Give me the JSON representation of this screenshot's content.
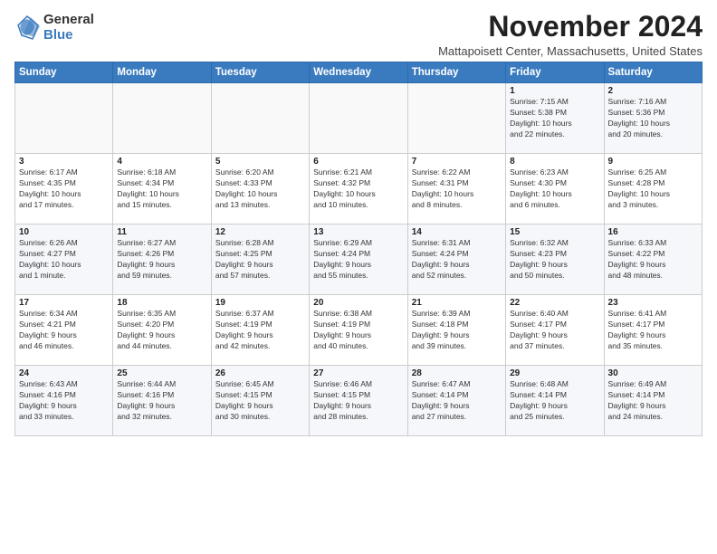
{
  "logo": {
    "general": "General",
    "blue": "Blue"
  },
  "title": "November 2024",
  "location": "Mattapoisett Center, Massachusetts, United States",
  "days_header": [
    "Sunday",
    "Monday",
    "Tuesday",
    "Wednesday",
    "Thursday",
    "Friday",
    "Saturday"
  ],
  "weeks": [
    [
      {
        "day": "",
        "detail": ""
      },
      {
        "day": "",
        "detail": ""
      },
      {
        "day": "",
        "detail": ""
      },
      {
        "day": "",
        "detail": ""
      },
      {
        "day": "",
        "detail": ""
      },
      {
        "day": "1",
        "detail": "Sunrise: 7:15 AM\nSunset: 5:38 PM\nDaylight: 10 hours\nand 22 minutes."
      },
      {
        "day": "2",
        "detail": "Sunrise: 7:16 AM\nSunset: 5:36 PM\nDaylight: 10 hours\nand 20 minutes."
      }
    ],
    [
      {
        "day": "3",
        "detail": "Sunrise: 6:17 AM\nSunset: 4:35 PM\nDaylight: 10 hours\nand 17 minutes."
      },
      {
        "day": "4",
        "detail": "Sunrise: 6:18 AM\nSunset: 4:34 PM\nDaylight: 10 hours\nand 15 minutes."
      },
      {
        "day": "5",
        "detail": "Sunrise: 6:20 AM\nSunset: 4:33 PM\nDaylight: 10 hours\nand 13 minutes."
      },
      {
        "day": "6",
        "detail": "Sunrise: 6:21 AM\nSunset: 4:32 PM\nDaylight: 10 hours\nand 10 minutes."
      },
      {
        "day": "7",
        "detail": "Sunrise: 6:22 AM\nSunset: 4:31 PM\nDaylight: 10 hours\nand 8 minutes."
      },
      {
        "day": "8",
        "detail": "Sunrise: 6:23 AM\nSunset: 4:30 PM\nDaylight: 10 hours\nand 6 minutes."
      },
      {
        "day": "9",
        "detail": "Sunrise: 6:25 AM\nSunset: 4:28 PM\nDaylight: 10 hours\nand 3 minutes."
      }
    ],
    [
      {
        "day": "10",
        "detail": "Sunrise: 6:26 AM\nSunset: 4:27 PM\nDaylight: 10 hours\nand 1 minute."
      },
      {
        "day": "11",
        "detail": "Sunrise: 6:27 AM\nSunset: 4:26 PM\nDaylight: 9 hours\nand 59 minutes."
      },
      {
        "day": "12",
        "detail": "Sunrise: 6:28 AM\nSunset: 4:25 PM\nDaylight: 9 hours\nand 57 minutes."
      },
      {
        "day": "13",
        "detail": "Sunrise: 6:29 AM\nSunset: 4:24 PM\nDaylight: 9 hours\nand 55 minutes."
      },
      {
        "day": "14",
        "detail": "Sunrise: 6:31 AM\nSunset: 4:24 PM\nDaylight: 9 hours\nand 52 minutes."
      },
      {
        "day": "15",
        "detail": "Sunrise: 6:32 AM\nSunset: 4:23 PM\nDaylight: 9 hours\nand 50 minutes."
      },
      {
        "day": "16",
        "detail": "Sunrise: 6:33 AM\nSunset: 4:22 PM\nDaylight: 9 hours\nand 48 minutes."
      }
    ],
    [
      {
        "day": "17",
        "detail": "Sunrise: 6:34 AM\nSunset: 4:21 PM\nDaylight: 9 hours\nand 46 minutes."
      },
      {
        "day": "18",
        "detail": "Sunrise: 6:35 AM\nSunset: 4:20 PM\nDaylight: 9 hours\nand 44 minutes."
      },
      {
        "day": "19",
        "detail": "Sunrise: 6:37 AM\nSunset: 4:19 PM\nDaylight: 9 hours\nand 42 minutes."
      },
      {
        "day": "20",
        "detail": "Sunrise: 6:38 AM\nSunset: 4:19 PM\nDaylight: 9 hours\nand 40 minutes."
      },
      {
        "day": "21",
        "detail": "Sunrise: 6:39 AM\nSunset: 4:18 PM\nDaylight: 9 hours\nand 39 minutes."
      },
      {
        "day": "22",
        "detail": "Sunrise: 6:40 AM\nSunset: 4:17 PM\nDaylight: 9 hours\nand 37 minutes."
      },
      {
        "day": "23",
        "detail": "Sunrise: 6:41 AM\nSunset: 4:17 PM\nDaylight: 9 hours\nand 35 minutes."
      }
    ],
    [
      {
        "day": "24",
        "detail": "Sunrise: 6:43 AM\nSunset: 4:16 PM\nDaylight: 9 hours\nand 33 minutes."
      },
      {
        "day": "25",
        "detail": "Sunrise: 6:44 AM\nSunset: 4:16 PM\nDaylight: 9 hours\nand 32 minutes."
      },
      {
        "day": "26",
        "detail": "Sunrise: 6:45 AM\nSunset: 4:15 PM\nDaylight: 9 hours\nand 30 minutes."
      },
      {
        "day": "27",
        "detail": "Sunrise: 6:46 AM\nSunset: 4:15 PM\nDaylight: 9 hours\nand 28 minutes."
      },
      {
        "day": "28",
        "detail": "Sunrise: 6:47 AM\nSunset: 4:14 PM\nDaylight: 9 hours\nand 27 minutes."
      },
      {
        "day": "29",
        "detail": "Sunrise: 6:48 AM\nSunset: 4:14 PM\nDaylight: 9 hours\nand 25 minutes."
      },
      {
        "day": "30",
        "detail": "Sunrise: 6:49 AM\nSunset: 4:14 PM\nDaylight: 9 hours\nand 24 minutes."
      }
    ]
  ]
}
